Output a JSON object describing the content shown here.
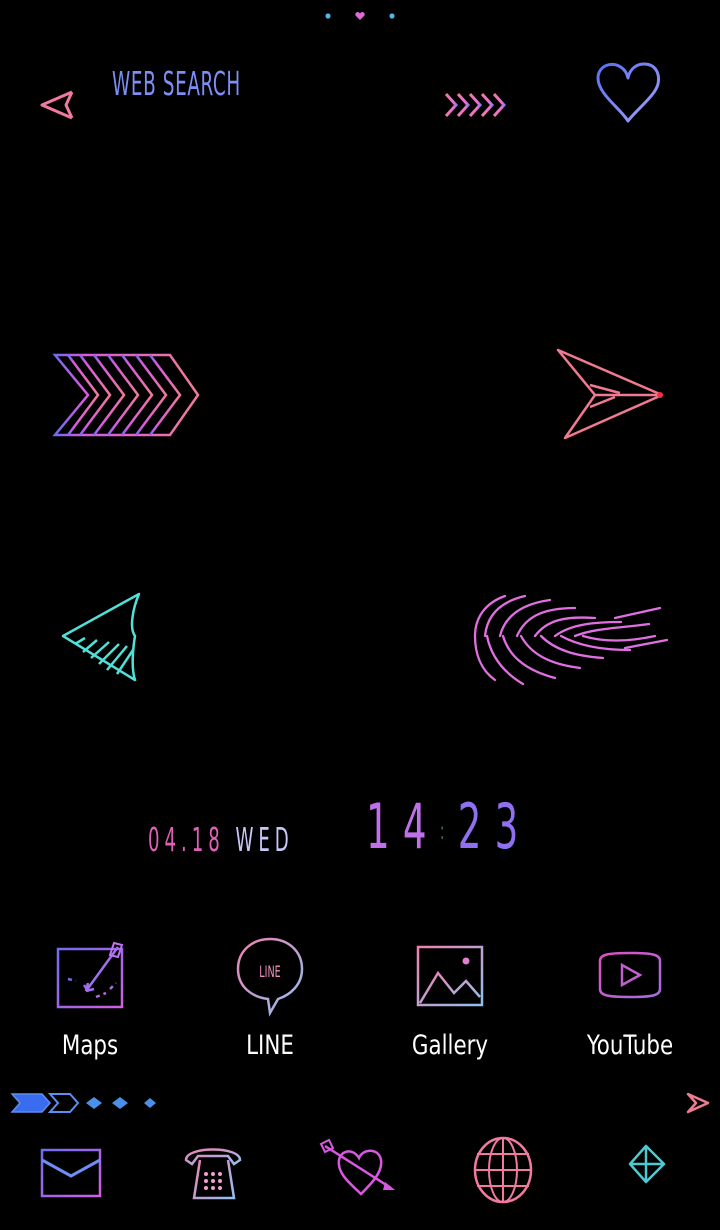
{
  "status_bar": {
    "page_indicator": [
      {
        "shape": "dot",
        "color": "#4fb6e8",
        "active": false
      },
      {
        "shape": "heart",
        "color": "#e06ad8",
        "active": true
      },
      {
        "shape": "dot",
        "color": "#4fb6e8",
        "active": false
      }
    ]
  },
  "search": {
    "label": "WEB SEARCH",
    "icon": "arrow-left-icon"
  },
  "favorites": {
    "icon": "heart-icon"
  },
  "decor": {
    "arrow_right": "arrow-right-decor",
    "arrow_left": "arrow-left-decor"
  },
  "clock": {
    "date": "04.18",
    "weekday": "WED",
    "hour": "14",
    "separator": ":",
    "minute": "23"
  },
  "apps": [
    {
      "label": "Maps",
      "icon": "map-icon"
    },
    {
      "label": "LINE",
      "icon": "line-chat-icon",
      "icon_text": "LINE"
    },
    {
      "label": "Gallery",
      "icon": "gallery-icon"
    },
    {
      "label": "YouTube",
      "icon": "play-icon"
    }
  ],
  "dock": [
    {
      "name": "mail",
      "icon": "envelope-icon"
    },
    {
      "name": "phone",
      "icon": "telephone-icon"
    },
    {
      "name": "messages",
      "icon": "heart-arrow-icon"
    },
    {
      "name": "browser",
      "icon": "globe-icon"
    },
    {
      "name": "app-drawer",
      "icon": "diamond-icon"
    }
  ],
  "colors": {
    "background": "#000000",
    "pink": "#f07aa8",
    "magenta": "#e05ad8",
    "purple": "#8a6cf0",
    "blue": "#6f8cf5",
    "cyan": "#4fd6e0",
    "label": "#ffffff"
  }
}
